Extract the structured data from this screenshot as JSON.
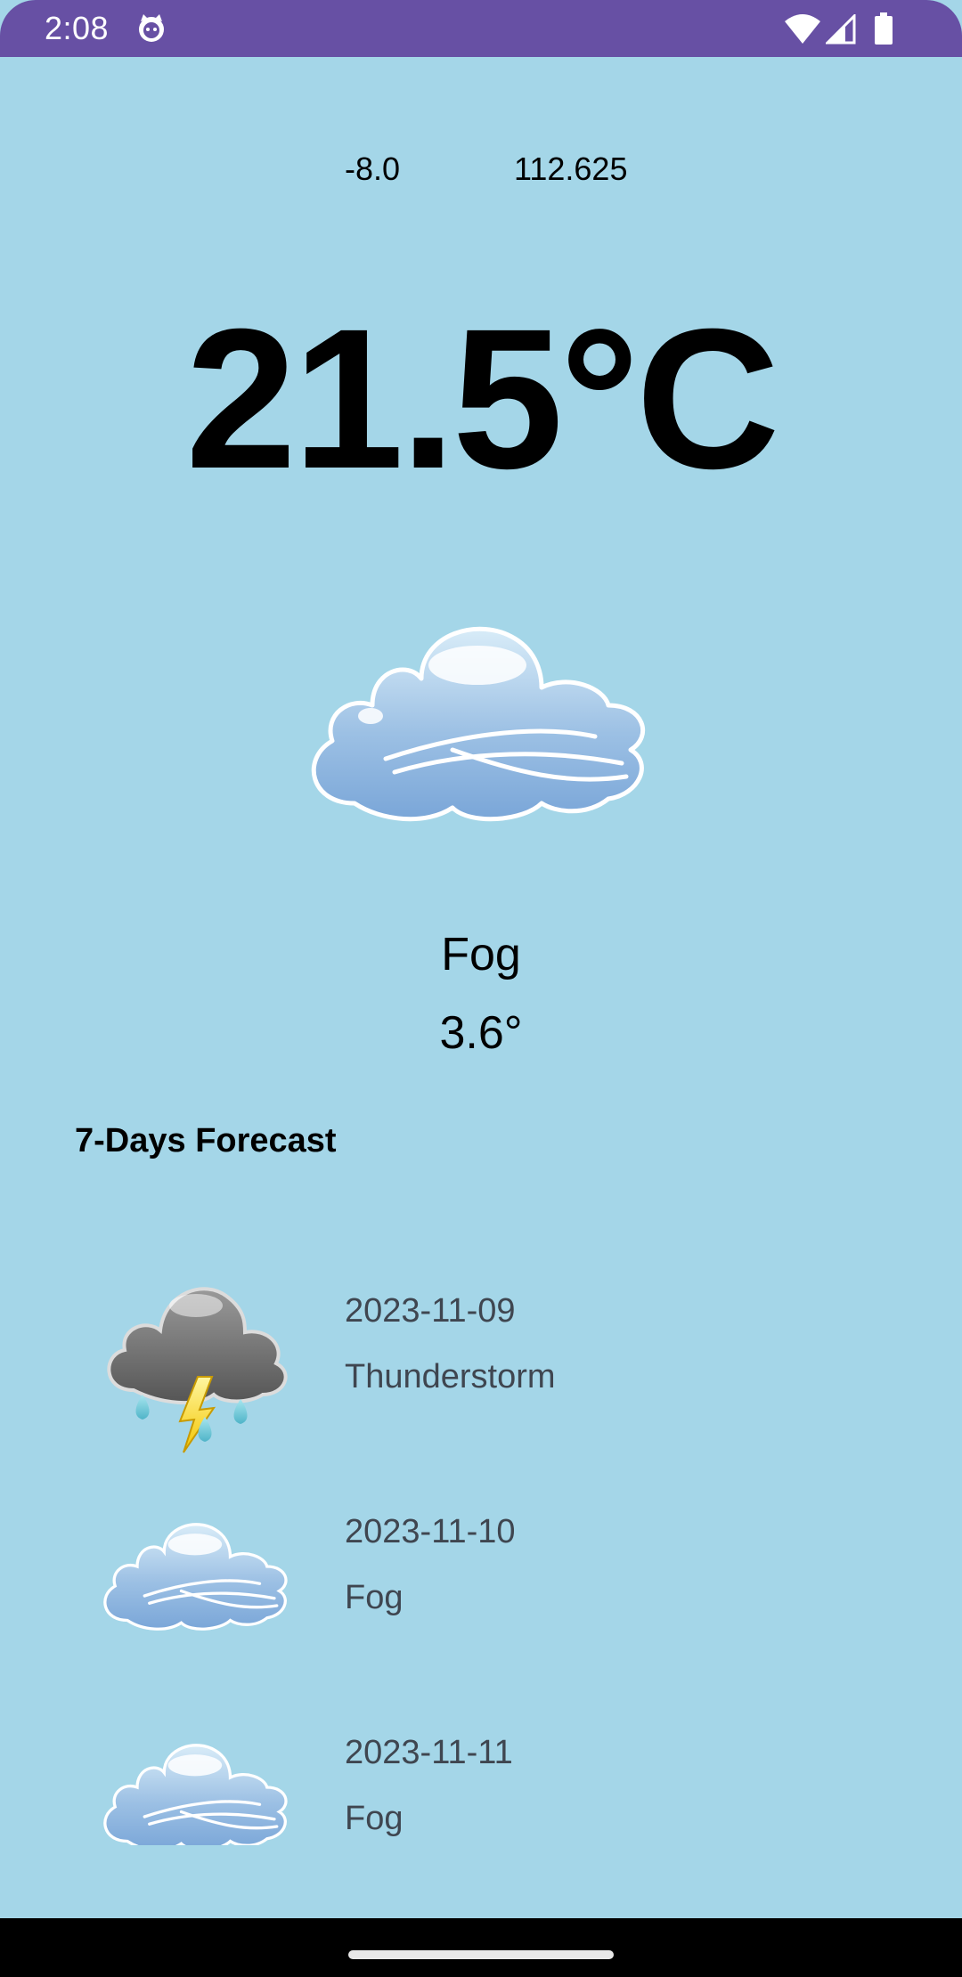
{
  "status_bar": {
    "time": "2:08",
    "background": "#6750a4",
    "icons": [
      "cat-face-icon",
      "wifi-icon",
      "cell-signal-icon",
      "battery-icon"
    ]
  },
  "location": {
    "latitude": "-8.0",
    "longitude": "112.625"
  },
  "current": {
    "temperature": "21.5°C",
    "condition": "Fog",
    "wind": "3.6°",
    "icon": "fog-cloud-icon"
  },
  "forecast": {
    "title": "7-Days Forecast",
    "items": [
      {
        "date": "2023-11-09",
        "condition": "Thunderstorm",
        "icon": "thunderstorm-icon"
      },
      {
        "date": "2023-11-10",
        "condition": "Fog",
        "icon": "fog-cloud-icon"
      },
      {
        "date": "2023-11-11",
        "condition": "Fog",
        "icon": "fog-cloud-icon"
      }
    ]
  },
  "colors": {
    "background": "#a4d6e8",
    "status_bar": "#6750a4",
    "nav_bar": "#000000",
    "secondary_text": "#3f4650"
  }
}
